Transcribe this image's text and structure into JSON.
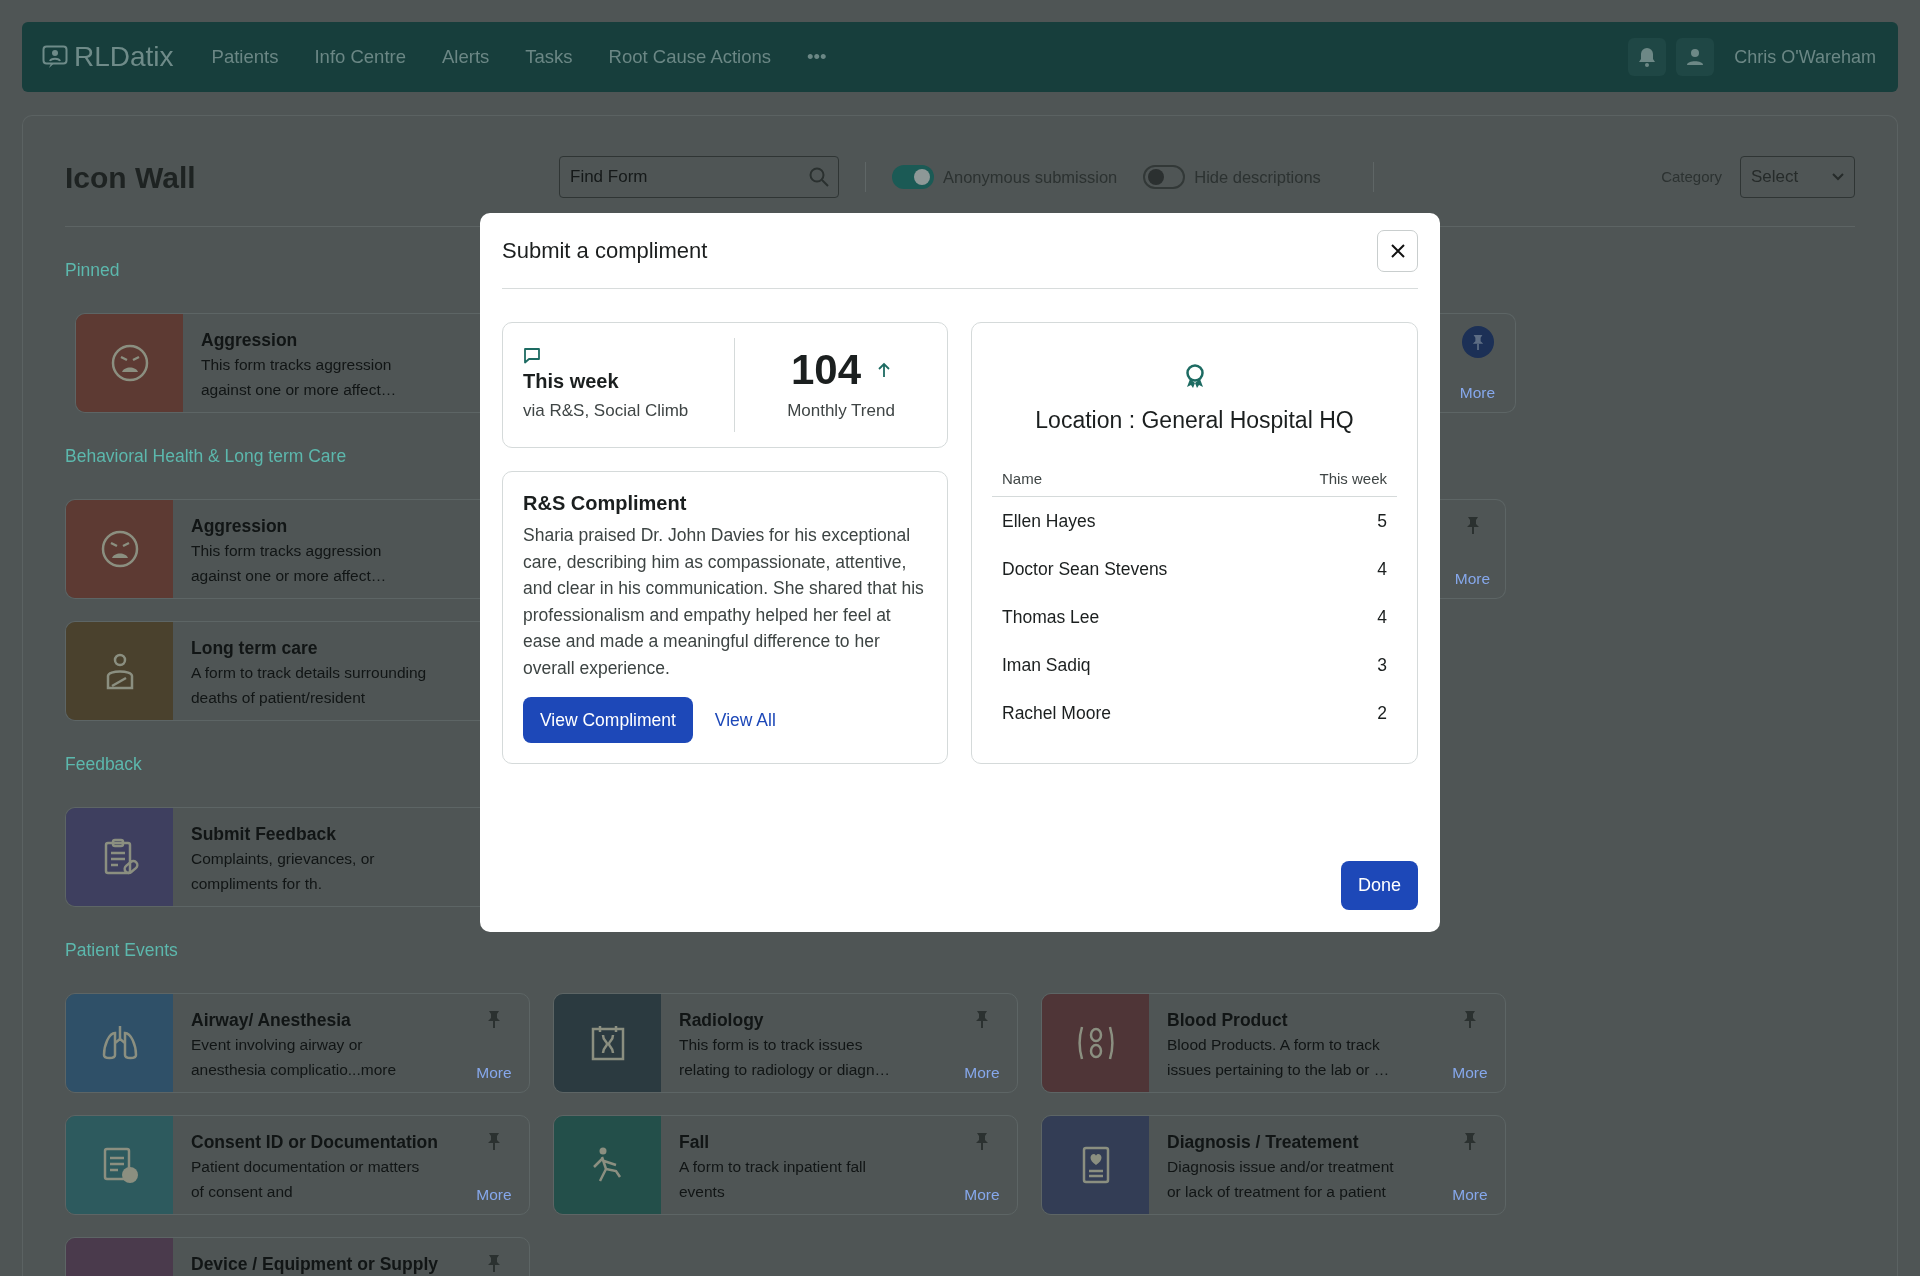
{
  "navbar": {
    "logo": "RLDatix",
    "links": [
      "Patients",
      "Info Centre",
      "Alerts",
      "Tasks",
      "Root Cause Actions",
      "•••"
    ],
    "user": "Chris O'Wareham"
  },
  "toolbar": {
    "title": "Icon Wall",
    "search": {
      "placeholder": "Find Form"
    },
    "toggles": [
      {
        "label": "Anonymous submission",
        "on": true
      },
      {
        "label": "Hide descriptions",
        "on": false
      }
    ],
    "category": {
      "label": "Category",
      "value": "Select"
    }
  },
  "sections": [
    {
      "title": "Pinned",
      "cards": [
        {
          "title": "Aggression",
          "description": "This form tracks aggression\nagainst one or more affect…",
          "color": "#5d3a33"
        },
        {
          "pinned": true,
          "more": "More"
        }
      ]
    },
    {
      "title": "Behavioral Health & Long term Care",
      "cards": [
        {
          "title": "Aggression",
          "description": "This form tracks aggression\nagainst one or more affect…",
          "color": "#5d3a33"
        },
        {
          "pinned": false,
          "more": "More"
        },
        {
          "title": "Long term care",
          "description": "A form to track details surrounding\ndeaths of patient/resident",
          "color": "#4a412d"
        }
      ]
    },
    {
      "title": "Feedback",
      "cards": [
        {
          "title": "Submit Feedback",
          "description": "Complaints, grievances, or\ncompliments for th.",
          "color": "#3e3f5f"
        }
      ]
    },
    {
      "title": "Patient Events",
      "cards": [
        {
          "title": "Airway/ Anesthesia",
          "description": "Event involving airway or\nanesthesia complicatio...more",
          "pinned": false,
          "more": "More",
          "color": "#2f5068"
        },
        {
          "title": "Radiology",
          "description": "This form is to track issues\nrelating to radiology or diagn…",
          "pinned": false,
          "more": "More",
          "color": "#2b3a40"
        },
        {
          "title": "Blood Product",
          "description": "Blood Products. A form to track\nissues pertaining to the lab or …",
          "pinned": false,
          "more": "More",
          "color": "#4f3537"
        },
        {
          "title": "Consent ID or Documentation",
          "description": "Patient documentation or matters\nof consent and",
          "pinned": false,
          "more": "More",
          "color": "#2d5a5e"
        },
        {
          "title": "Fall",
          "description": "A form to track inpatient fall\nevents",
          "pinned": false,
          "more": "More",
          "color": "#234f4a"
        },
        {
          "title": "Diagnosis / Treatement",
          "description": "Diagnosis issue and/or treatment\nor lack of treatment for a patient",
          "pinned": false,
          "more": "More",
          "color": "#333d55"
        },
        {
          "title": "Device / Equipment or Supply",
          "pinned": false,
          "color": "#4a3a4c"
        }
      ]
    }
  ],
  "modal": {
    "title": "Submit a compliment",
    "stats": {
      "label": "This week",
      "source": "via R&S, Social Climb",
      "count": "104",
      "trend": "Monthly Trend"
    },
    "compliment": {
      "title": "R&S Compliment",
      "text": "Sharia praised Dr. John Davies for his exceptional care, describing him as compassionate, attentive, and clear in his communication. She shared that his professionalism and empathy helped her feel at ease and made a meaningful difference to her overall experience.",
      "primary": "View Compliment",
      "link": "View All"
    },
    "location": {
      "title": "Location : General Hospital HQ",
      "columns": [
        "Name",
        "This week"
      ],
      "rows": [
        [
          "Ellen Hayes",
          "5"
        ],
        [
          "Doctor Sean Stevens",
          "4"
        ],
        [
          "Thomas Lee",
          "4"
        ],
        [
          "Iman Sadiq",
          "3"
        ],
        [
          "Rachel Moore",
          "2"
        ]
      ]
    },
    "done": "Done"
  }
}
